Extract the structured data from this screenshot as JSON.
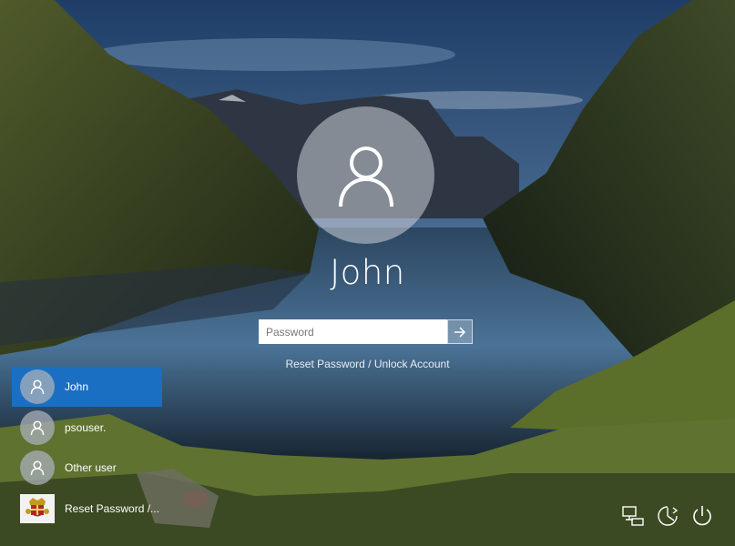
{
  "login": {
    "username": "John",
    "password_placeholder": "Password",
    "reset_link": "Reset Password / Unlock Account"
  },
  "users": [
    {
      "label": "John",
      "selected": true,
      "icon": "user-icon"
    },
    {
      "label": "psouser.",
      "selected": false,
      "icon": "user-icon"
    },
    {
      "label": "Other user",
      "selected": false,
      "icon": "user-icon"
    },
    {
      "label": "Reset Password /...",
      "selected": false,
      "icon": "crest-icon"
    }
  ],
  "system_icons": [
    "network-icon",
    "ease-of-access-icon",
    "power-icon"
  ],
  "colors": {
    "selected_user": "#1a6fc2",
    "input_bg": "#ffffff"
  }
}
